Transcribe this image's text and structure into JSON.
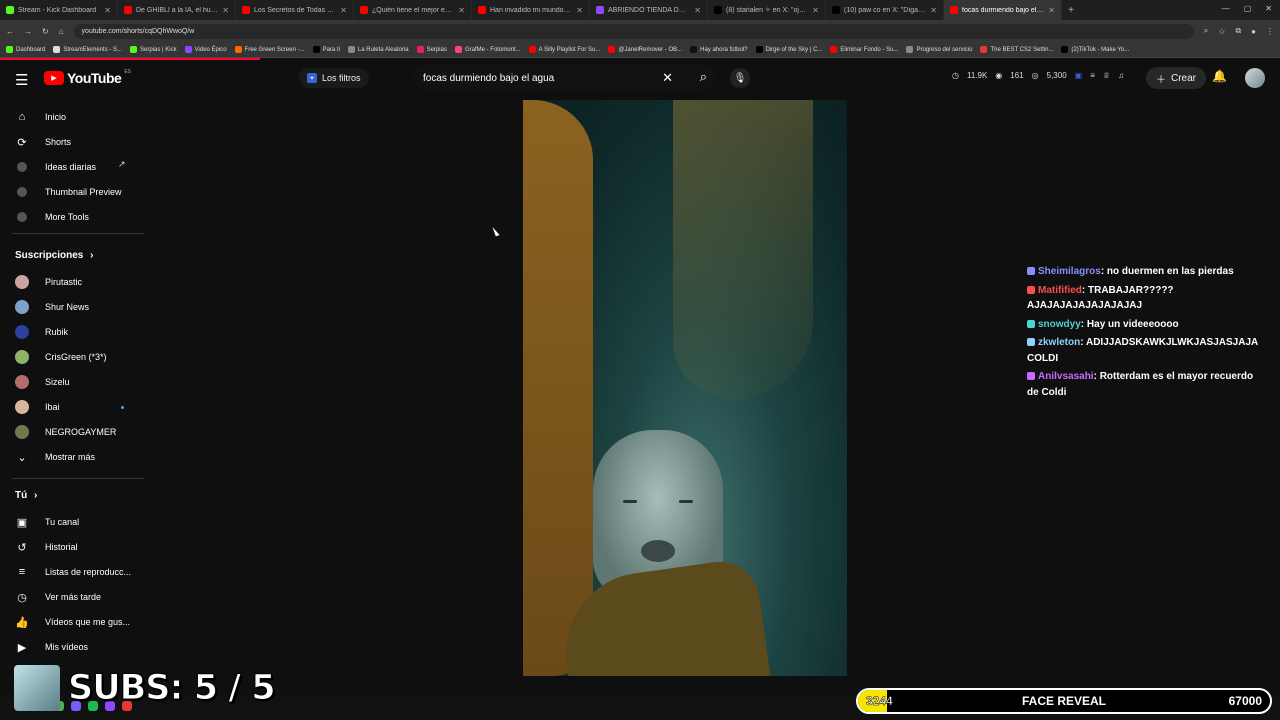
{
  "browser": {
    "tabs": [
      {
        "title": "Stream - Kick Dashboard",
        "color": "#53fc18"
      },
      {
        "title": "De GHIBLI a la IA, el hundimien",
        "color": "#ff0000"
      },
      {
        "title": "Los Secretos de Todas Las Estru",
        "color": "#ff0000"
      },
      {
        "title": "¿Quién tiene el mejor estilo? Ll",
        "color": "#ff0000"
      },
      {
        "title": "Han invadido mi mundo surviv",
        "color": "#ff0000"
      },
      {
        "title": "ABRIENDO TIENDA DE POKE",
        "color": "#9146ff"
      },
      {
        "title": "(8) starialen ✧ en X: \"ojalá diff",
        "color": "#000000"
      },
      {
        "title": "(10) paw co en X: \"Díganle a Se",
        "color": "#000000"
      },
      {
        "title": "focas durmiendo bajo el agua",
        "color": "#ff0000",
        "active": true
      }
    ],
    "url": "youtube.com/shorts/cqDQhWwoQ/w",
    "bookmarks": [
      "Dashboard",
      "StreamElements - S...",
      "Serpias | Kick",
      "Video Épico",
      "Free Green Screen -...",
      "Para ti",
      "La Ruleta Aleatoria",
      "Serpias",
      "GrafMe - Fotomont...",
      "A Silly Playlist For Su...",
      "@JanelRemover - OB...",
      "Hay ahora fútbol?",
      "Dirge of the Sky | C...",
      "Eliminar Fondo - Su...",
      "Progreso del servicio",
      "The BEST CS2 Settin...",
      "(2)TikTok - Make Yo..."
    ]
  },
  "header": {
    "logo_text": "YouTube",
    "region": "ES",
    "filters_label": "Los filtros",
    "search_value": "focas durmiendo bajo el agua",
    "stats": [
      "11.9K",
      "161",
      "5,300"
    ],
    "create_label": "Crear"
  },
  "sidebar": {
    "main": [
      {
        "label": "Inicio",
        "icon": "home-icon"
      },
      {
        "label": "Shorts",
        "icon": "shorts-icon"
      },
      {
        "label": "Ideas diarias",
        "icon": "dot-icon"
      },
      {
        "label": "Thumbnail Preview",
        "icon": "dot-icon"
      },
      {
        "label": "More Tools",
        "icon": "dot-icon"
      }
    ],
    "subs_title": "Suscripciones",
    "subs": [
      {
        "label": "Pirutastic",
        "color": "#c9a4a4"
      },
      {
        "label": "Shur News",
        "color": "#7ea3c8"
      },
      {
        "label": "Rubik",
        "color": "#2b3f9c"
      },
      {
        "label": "CrisGreen (*3*)",
        "color": "#8fb26a"
      },
      {
        "label": "Sizelu",
        "color": "#b56b6b"
      },
      {
        "label": "Ibai",
        "color": "#d7b69a"
      },
      {
        "label": "NEGROGAYMER",
        "color": "#6d7a4f"
      }
    ],
    "show_more": "Mostrar más",
    "you_title": "Tú",
    "you": [
      {
        "label": "Tu canal",
        "icon": "channel-icon"
      },
      {
        "label": "Historial",
        "icon": "history-icon"
      },
      {
        "label": "Listas de reproducc...",
        "icon": "playlist-icon"
      },
      {
        "label": "Ver más tarde",
        "icon": "clock-icon"
      },
      {
        "label": "Vídeos que me gus...",
        "icon": "like-icon"
      },
      {
        "label": "Mis vídeos",
        "icon": "video-icon"
      }
    ]
  },
  "chat": [
    {
      "user": "Sheimilagros",
      "color": "#8c8cff",
      "text": ": no duermen en las pierdas"
    },
    {
      "user": "Matifified",
      "color": "#ff4d4d",
      "text": ": TRABAJAR????? AJAJAJAJAJAJAJAJAJ"
    },
    {
      "user": "snowdyy",
      "color": "#4fd2d2",
      "text": ": Hay un videeeoooo"
    },
    {
      "user": "zkwleton",
      "color": "#8fd1ff",
      "text": ": ADIJJADSKAWKJLWKJASJASJAJA COLDI"
    },
    {
      "user": "Anilvsasahi",
      "color": "#c86bff",
      "text": ": Rotterdam es el mayor recuerdo de Coldi"
    }
  ],
  "overlay": {
    "subs_text": "SUBS: 5 / 5",
    "goal_current": "3244",
    "goal_label": "FACE REVEAL",
    "goal_target": "67000",
    "goal_progress": 0.048
  }
}
